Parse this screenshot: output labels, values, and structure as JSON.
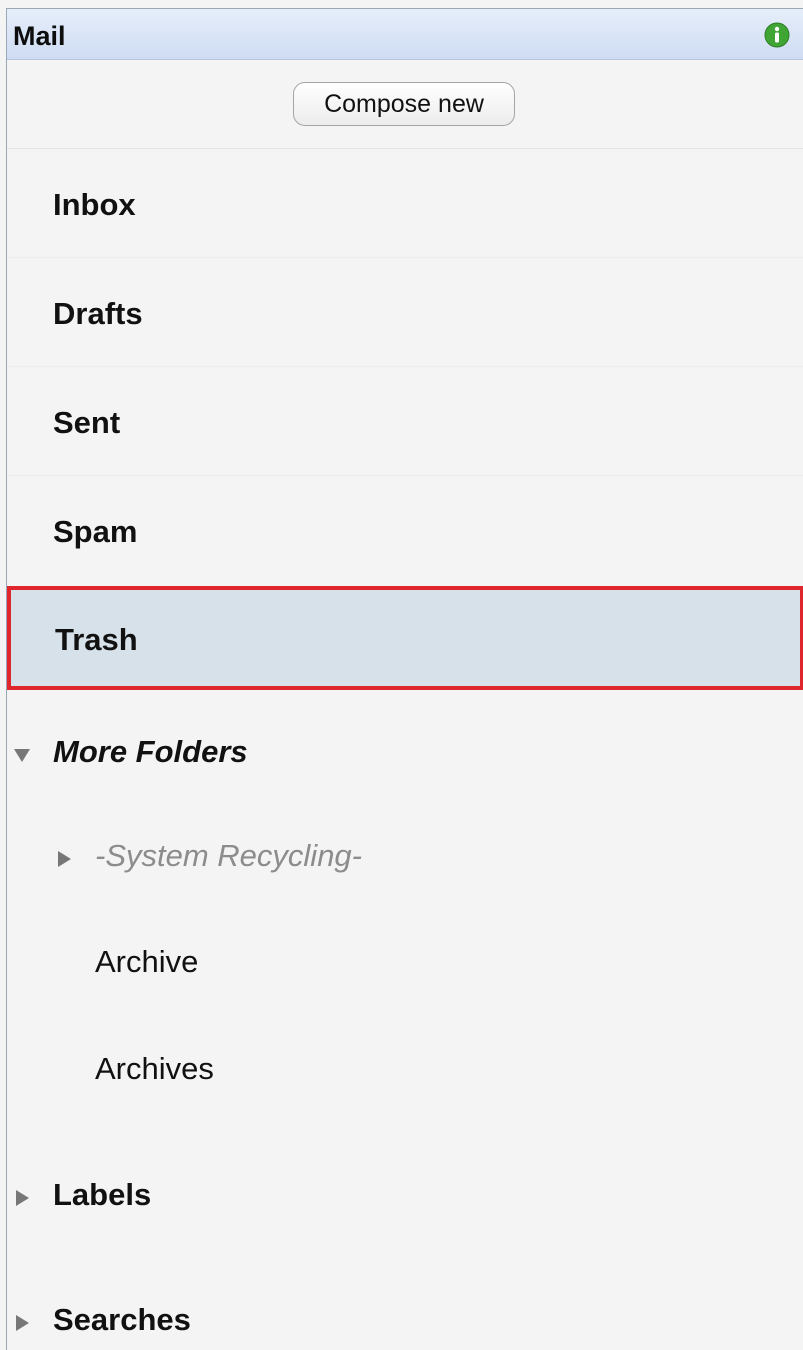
{
  "header": {
    "title": "Mail",
    "info_icon": "info-icon",
    "info_color": "#3fa535"
  },
  "compose": {
    "label": "Compose new"
  },
  "folders": [
    {
      "label": "Inbox"
    },
    {
      "label": "Drafts"
    },
    {
      "label": "Sent"
    },
    {
      "label": "Spam"
    },
    {
      "label": "Trash",
      "selected": true
    }
  ],
  "more_folders": {
    "label": "More Folders",
    "expanded": true,
    "items": [
      {
        "label": "-System Recycling-",
        "collapsed": true
      },
      {
        "label": "Archive"
      },
      {
        "label": "Archives"
      }
    ]
  },
  "labels": {
    "label": "Labels",
    "expanded": false
  },
  "searches": {
    "label": "Searches",
    "expanded": false
  },
  "colors": {
    "selected_bg": "#d6e1e9",
    "highlight_border": "#e0262d",
    "header_bg": "#d7e2f5"
  }
}
